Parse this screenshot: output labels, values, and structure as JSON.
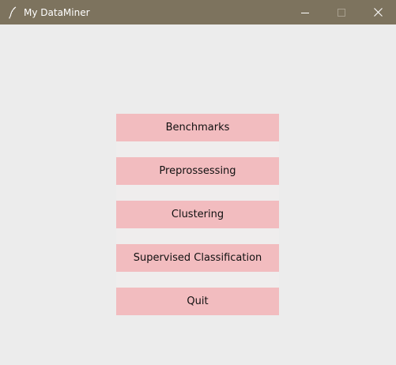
{
  "window": {
    "title": "My DataMiner",
    "titlebar_color": "#7d735e",
    "background_color": "#ececec",
    "app_icon": "feather-icon",
    "controls": [
      "minimize-icon",
      "maximize-icon",
      "close-icon"
    ]
  },
  "menu": {
    "button_color": "#f2bcbf",
    "buttons": [
      {
        "label": "Benchmarks"
      },
      {
        "label": "Preprossessing"
      },
      {
        "label": "Clustering"
      },
      {
        "label": "Supervised Classification"
      },
      {
        "label": "Quit"
      }
    ]
  }
}
